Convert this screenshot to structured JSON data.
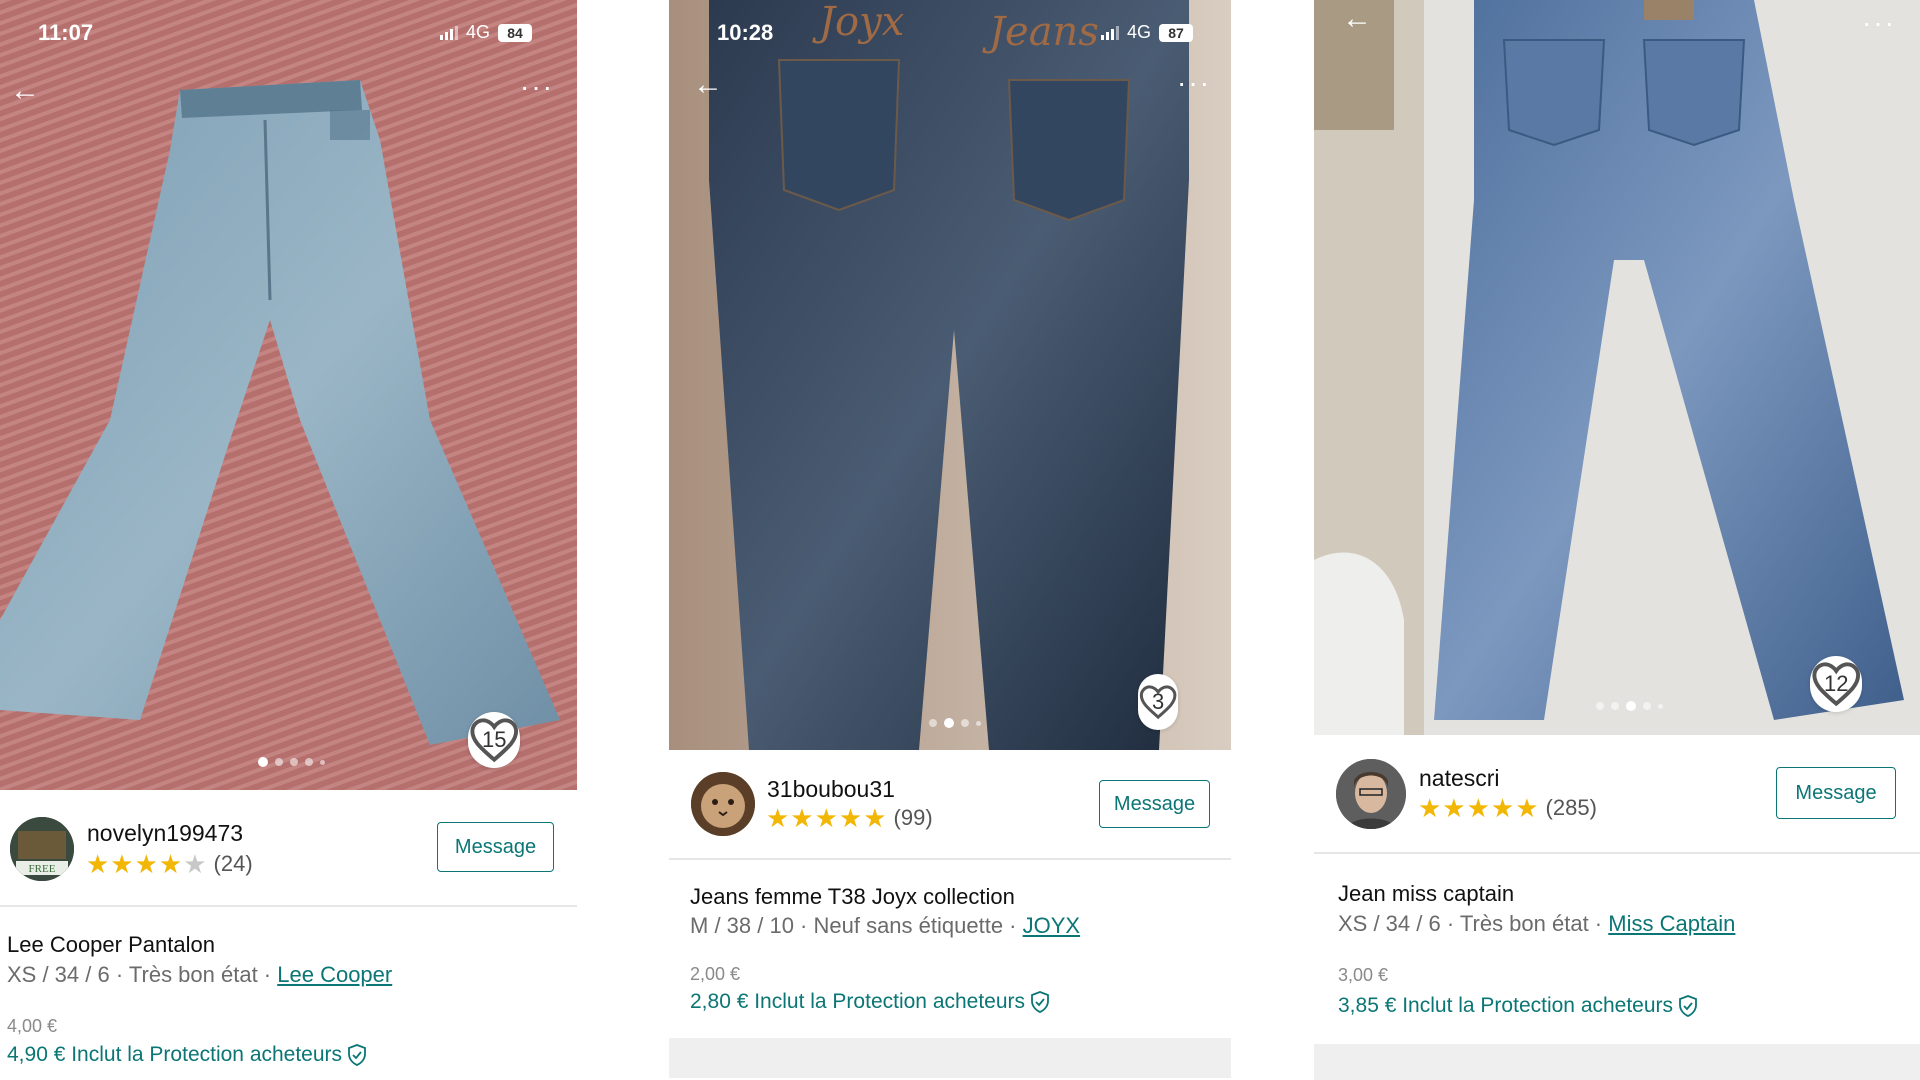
{
  "listings": [
    {
      "status": {
        "time": "11:07",
        "network": "4G",
        "battery": "84"
      },
      "likes": "15",
      "seller": {
        "name": "novelyn199473",
        "rating_count": "(24)",
        "stars": 4,
        "avatar_text": "FREE"
      },
      "message_label": "Message",
      "title": "Lee Cooper Pantalon",
      "details": "XS / 34 / 6 · Très bon état · ",
      "brand": "Lee Cooper",
      "price": "4,00 €",
      "price_protected": "4,90 € Inclut la Protection acheteurs"
    },
    {
      "status": {
        "time": "10:28",
        "network": "4G",
        "battery": "87"
      },
      "likes": "3",
      "seller": {
        "name": "31boubou31",
        "rating_count": "(99)",
        "stars": 5
      },
      "message_label": "Message",
      "title": "Jeans femme T38 Joyx collection",
      "details": "M / 38 / 10 · Neuf sans étiquette · ",
      "brand": "JOYX",
      "price": "2,00 €",
      "price_protected": "2,80 € Inclut la Protection acheteurs"
    },
    {
      "likes": "12",
      "seller": {
        "name": "natescri",
        "rating_count": "(285)",
        "stars": 5
      },
      "message_label": "Message",
      "title": "Jean miss captain",
      "details": "XS / 34 / 6 · Très bon état · ",
      "brand": "Miss Captain",
      "price": "3,00 €",
      "price_protected": "3,85 € Inclut la Protection acheteurs"
    }
  ],
  "icons": {
    "back": "back-arrow-icon",
    "more": "more-icon",
    "heart": "heart-icon",
    "shield": "shield-check-icon"
  },
  "colors": {
    "accent": "#0b7675",
    "star": "#f2b705"
  }
}
